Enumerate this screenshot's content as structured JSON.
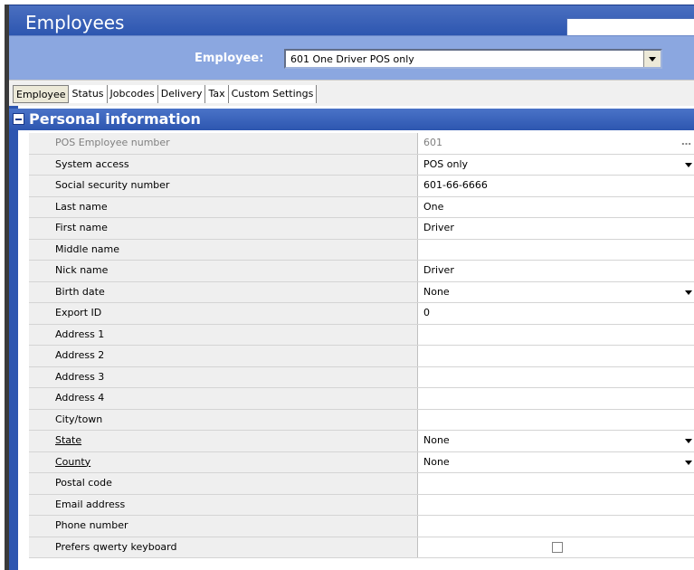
{
  "window": {
    "title": "Employees"
  },
  "selector": {
    "label": "Employee:",
    "value": "601 One Driver POS only"
  },
  "tabs": [
    {
      "label": "Employee",
      "active": true
    },
    {
      "label": "Status",
      "active": false
    },
    {
      "label": "Jobcodes",
      "active": false
    },
    {
      "label": "Delivery",
      "active": false
    },
    {
      "label": "Tax",
      "active": false
    },
    {
      "label": "Custom Settings",
      "active": false
    }
  ],
  "section": {
    "title": "Personal information"
  },
  "rows": [
    {
      "label": "POS Employee number",
      "value": "601",
      "disabled": true,
      "control": "ellipsis"
    },
    {
      "label": "System access",
      "value": "POS only",
      "control": "dropdown"
    },
    {
      "label": "Social security number",
      "value": "601-66-6666"
    },
    {
      "label": "Last name",
      "value": "One"
    },
    {
      "label": "First name",
      "value": "Driver"
    },
    {
      "label": "Middle name",
      "value": ""
    },
    {
      "label": "Nick name",
      "value": "Driver"
    },
    {
      "label": "Birth date",
      "value": "None",
      "control": "dropdown"
    },
    {
      "label": "Export ID",
      "value": "0"
    },
    {
      "label": "Address 1",
      "value": ""
    },
    {
      "label": "Address 2",
      "value": ""
    },
    {
      "label": "Address 3",
      "value": ""
    },
    {
      "label": "Address 4",
      "value": ""
    },
    {
      "label": "City/town",
      "value": ""
    },
    {
      "label": "State",
      "value": "None",
      "control": "dropdown",
      "link": true
    },
    {
      "label": "County",
      "value": "None",
      "control": "dropdown",
      "link": true
    },
    {
      "label": "Postal code",
      "value": ""
    },
    {
      "label": "Email address",
      "value": ""
    },
    {
      "label": "Phone number",
      "value": ""
    },
    {
      "label": "Prefers qwerty keyboard",
      "value": "",
      "control": "checkbox",
      "checked": false
    }
  ],
  "colors": {
    "titlebar": "#2d56b0",
    "selector_bg": "#8ba7e0",
    "label_bg": "#efefef"
  }
}
